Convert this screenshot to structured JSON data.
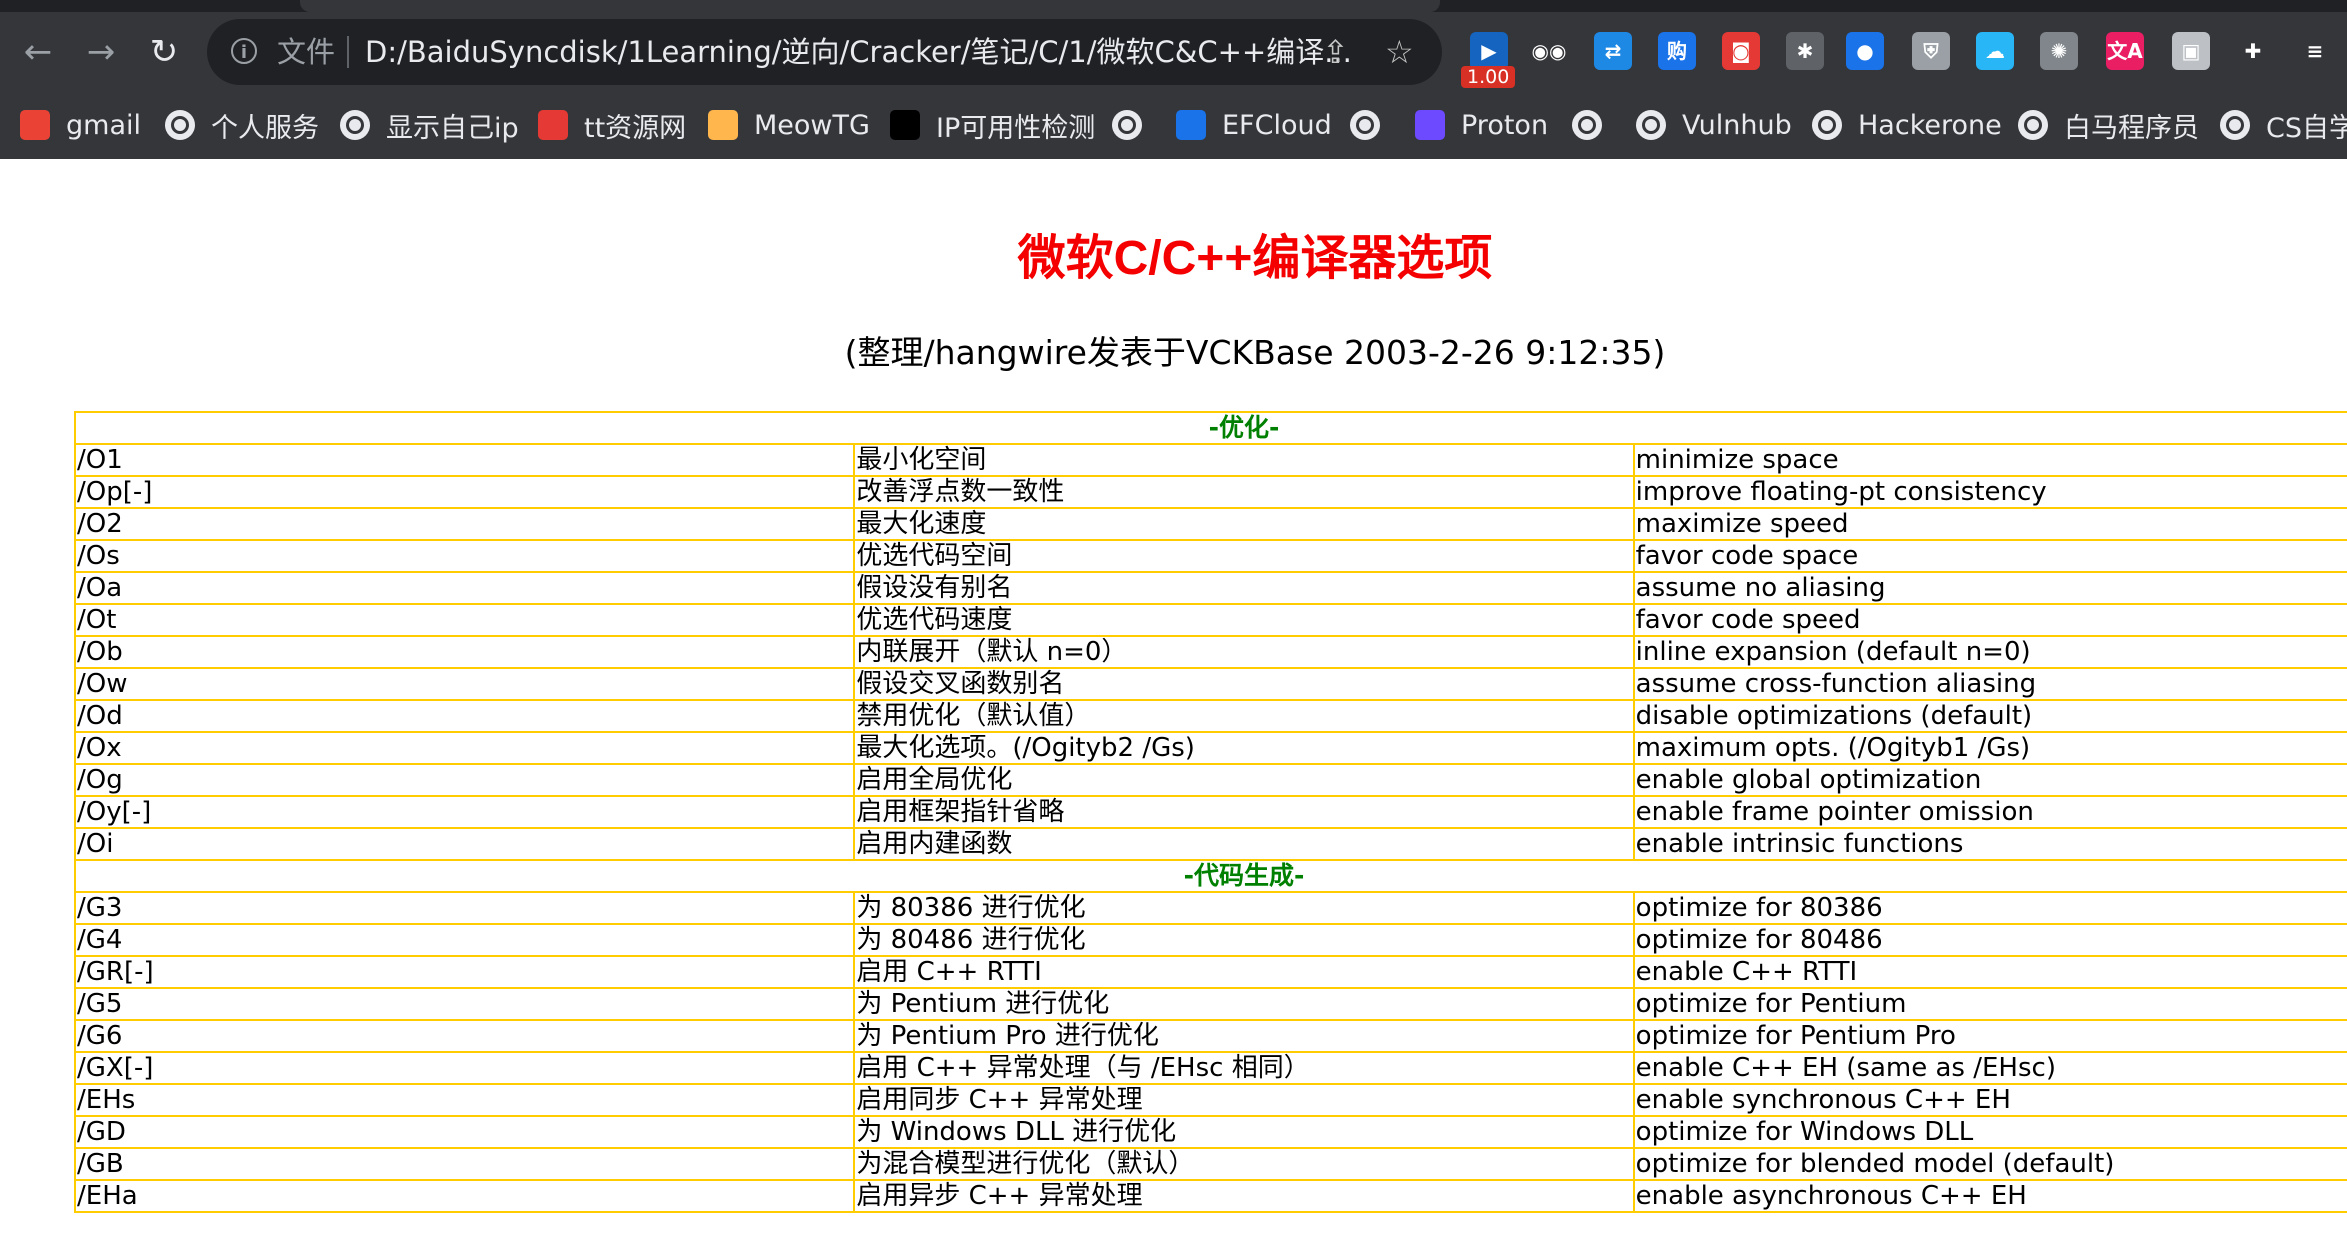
{
  "browser": {
    "scheme_label": "文件",
    "url": "D:/BaiduSyncdisk/1Learning/逆向/Cracker/笔记/C/1/微软C&C++编译...",
    "extension_badge": "1.00",
    "extensions": [
      {
        "name": "speed-extension-icon",
        "color": "#1565c0",
        "glyph": "▶"
      },
      {
        "name": "spy-extension-icon",
        "color": "#35363a",
        "glyph": "◉◉"
      },
      {
        "name": "translate-extension-icon",
        "color": "#1e88e5",
        "glyph": "⇄"
      },
      {
        "name": "shopping-extension-icon",
        "color": "#1a73e8",
        "glyph": "购"
      },
      {
        "name": "screenshot-extension-icon",
        "color": "#e53935",
        "glyph": "◙"
      },
      {
        "name": "bug-extension-icon",
        "color": "#5f6368",
        "glyph": "✱"
      },
      {
        "name": "blue-orb-extension-icon",
        "color": "#1a73e8",
        "glyph": "●"
      },
      {
        "name": "shield-extension-icon",
        "color": "#9aa0a6",
        "glyph": "⛨"
      },
      {
        "name": "cloud-extension-icon",
        "color": "#29b6f6",
        "glyph": "☁"
      },
      {
        "name": "octopus-extension-icon",
        "color": "#80868b",
        "glyph": "✺"
      },
      {
        "name": "dictionary-extension-icon",
        "color": "#e91e63",
        "glyph": "文A"
      },
      {
        "name": "image-extension-icon",
        "color": "#bdc1c6",
        "glyph": "▣"
      },
      {
        "name": "puzzle-extensions-icon",
        "color": "#35363a",
        "glyph": "✚"
      },
      {
        "name": "reading-list-icon",
        "color": "#35363a",
        "glyph": "≡"
      }
    ]
  },
  "bookmarks": [
    {
      "label": "gmail",
      "icon": "gmail-icon",
      "color": "#ea4335"
    },
    {
      "label": "个人服务",
      "icon": "globe-icon",
      "color": "#e8eaed"
    },
    {
      "label": "显示自己ip",
      "icon": "globe-icon",
      "color": "#e8eaed"
    },
    {
      "label": "tt资源网",
      "icon": "tt-icon",
      "color": "#e53935"
    },
    {
      "label": "MeowTG",
      "icon": "cat-icon",
      "color": "#ffb74d"
    },
    {
      "label": "IP可用性检测",
      "icon": "tools-icon",
      "color": "#000000"
    },
    {
      "label": "",
      "icon": "globe-icon",
      "color": "#e8eaed"
    },
    {
      "label": "EFCloud",
      "icon": "rocket-icon",
      "color": "#1a73e8"
    },
    {
      "label": "",
      "icon": "globe-icon",
      "color": "#e8eaed"
    },
    {
      "label": "Proton",
      "icon": "proton-icon",
      "color": "#6d4aff"
    },
    {
      "label": "",
      "icon": "globe-icon",
      "color": "#e8eaed"
    },
    {
      "label": "Vulnhub",
      "icon": "globe-icon",
      "color": "#e8eaed"
    },
    {
      "label": "Hackerone",
      "icon": "globe-icon",
      "color": "#e8eaed"
    },
    {
      "label": "白马程序员",
      "icon": "globe-icon",
      "color": "#e8eaed"
    },
    {
      "label": "CS自学",
      "icon": "globe-icon",
      "color": "#e8eaed"
    }
  ],
  "page": {
    "title": "微软C/C++编译器选项",
    "subtitle": "(整理/hangwire发表于VCKBase 2003-2-26 9:12:35)",
    "sections": [
      {
        "heading": "-优化-",
        "rows": [
          [
            "/O1",
            "最小化空间",
            "minimize space"
          ],
          [
            "/Op[-]",
            "改善浮点数一致性",
            "improve floating-pt consistency"
          ],
          [
            "/O2",
            "最大化速度",
            "maximize speed"
          ],
          [
            "/Os",
            "优选代码空间",
            "favor code space"
          ],
          [
            "/Oa",
            "假设没有别名",
            "assume no aliasing"
          ],
          [
            "/Ot",
            "优选代码速度",
            "favor code speed"
          ],
          [
            "/Ob",
            "内联展开（默认 n=0）",
            "inline expansion (default n=0)"
          ],
          [
            "/Ow",
            "假设交叉函数别名",
            "assume cross-function aliasing"
          ],
          [
            "/Od",
            "禁用优化（默认值）",
            "disable optimizations (default)"
          ],
          [
            "/Ox",
            "最大化选项。(/Ogityb2 /Gs)",
            "maximum opts. (/Ogityb1 /Gs)"
          ],
          [
            "/Og",
            "启用全局优化",
            "enable global optimization"
          ],
          [
            "/Oy[-]",
            "启用框架指针省略",
            "enable frame pointer omission"
          ],
          [
            "/Oi",
            "启用内建函数",
            "enable intrinsic functions"
          ]
        ]
      },
      {
        "heading": "-代码生成-",
        "rows": [
          [
            "/G3",
            "为 80386 进行优化",
            "optimize for 80386"
          ],
          [
            "/G4",
            "为 80486 进行优化",
            "optimize for 80486"
          ],
          [
            "/GR[-]",
            "启用 C++ RTTI",
            "enable C++ RTTI"
          ],
          [
            "/G5",
            "为 Pentium 进行优化",
            "optimize for Pentium"
          ],
          [
            "/G6",
            "为 Pentium Pro 进行优化",
            "optimize for Pentium Pro"
          ],
          [
            "/GX[-]",
            "启用 C++ 异常处理（与 /EHsc 相同）",
            "enable C++ EH (same as /EHsc)"
          ],
          [
            "/EHs",
            "启用同步 C++ 异常处理",
            "enable synchronous C++ EH"
          ],
          [
            "/GD",
            "为 Windows DLL 进行优化",
            "optimize for Windows DLL"
          ],
          [
            "/GB",
            "为混合模型进行优化（默认）",
            "optimize for blended model (default)"
          ],
          [
            "/EHa",
            "启用异步 C++ 异常处理",
            "enable asynchronous C++ EH"
          ]
        ]
      }
    ]
  }
}
